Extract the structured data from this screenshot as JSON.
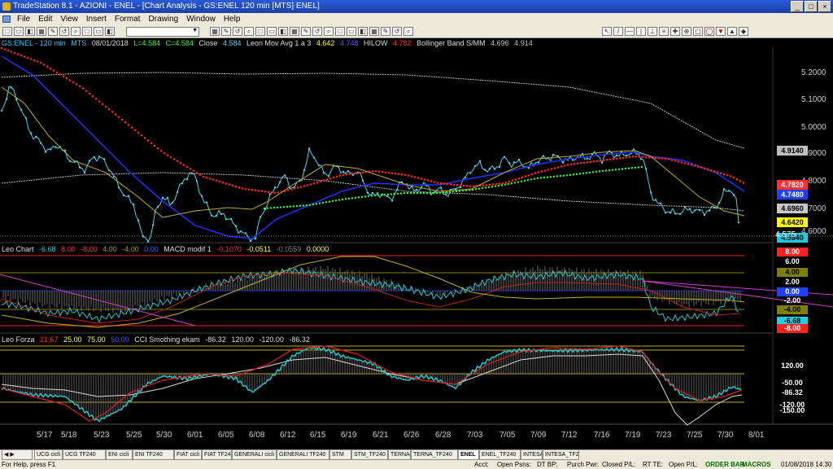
{
  "window": {
    "title": "TradeStation 8.1 - AZIONI - ENEL - [Chart Analysis - GS:ENEL  120 min  [MTS] ENEL]"
  },
  "menu": [
    "File",
    "Edit",
    "View",
    "Insert",
    "Format",
    "Drawing",
    "Window",
    "Help"
  ],
  "header": {
    "symbol": "GS:ENEL - 120 min",
    "source": "MTS",
    "date": "08/01/2018",
    "low": "L=4.584",
    "close": "C=4.584",
    "close_label": "Close",
    "close_val": "4.584",
    "ma_label": "Leon Mov Avg 1 a 3",
    "ma_val": "4.642",
    "ma_val2": "4.748",
    "hilow_label": "HILOW",
    "hilow_val": "4.782",
    "bb_label": "Bollinger Band S/MM",
    "bb_val1": "4.696",
    "bb_val2": "4.914"
  },
  "panel2_header": {
    "label": "Leo Chart",
    "v1": "-6.68",
    "v2": "8.00",
    "v3": "-8.00",
    "v4": "4.00",
    "v5": "-4.00",
    "v6": "0.00",
    "macd_label": "MACD modif 1",
    "m1": "-0.1070",
    "m2": "-0.0511",
    "m3": "-0.0559",
    "m4": "0.0000"
  },
  "panel3_header": {
    "label": "Leo Forza",
    "v1": "21.67",
    "v2": "25.00",
    "v3": "75.00",
    "v4": "50.00",
    "cci_label": "CCI Smothing ekam",
    "c1": "-86.32",
    "c2": "120.00",
    "c3": "-120.00",
    "c4": "-86.32"
  },
  "price_axis": [
    "5.2000",
    "5.1000",
    "5.0000",
    "4.9000",
    "4.8000",
    "4.7000",
    "4.6000"
  ],
  "price_boxes": [
    {
      "text": "4.9140",
      "bg": "#bfbfbf"
    },
    {
      "text": "4.7820",
      "bg": "#ff3030"
    },
    {
      "text": "4.7480",
      "bg": "#2040ff"
    },
    {
      "text": "4.6960",
      "bg": "#c8c8c8"
    },
    {
      "text": "4.6420",
      "bg": "#ffff00"
    },
    {
      "text": "4.5840",
      "bg": "#20c8e0"
    }
  ],
  "last_price_label": "4.575",
  "panel2_axis": [
    {
      "text": "8.00",
      "bg": "#ff2020"
    },
    {
      "text": "6.00",
      "bg": ""
    },
    {
      "text": "4.00",
      "bg": "#808000"
    },
    {
      "text": "2.00",
      "bg": ""
    },
    {
      "text": "0.00",
      "bg": "#2040ff"
    },
    {
      "text": "-2.00",
      "bg": ""
    },
    {
      "text": "-4.00",
      "bg": "#808000"
    },
    {
      "text": "-6.68",
      "bg": "#20d0e0"
    },
    {
      "text": "-8.00",
      "bg": "#ff2020"
    }
  ],
  "panel3_axis": [
    {
      "text": "120.00",
      "bg": ""
    },
    {
      "text": "-50.00",
      "bg": ""
    },
    {
      "text": "-86.32",
      "bg": ""
    },
    {
      "text": "-120.00",
      "bg": ""
    },
    {
      "text": "-150.00",
      "bg": ""
    }
  ],
  "dates": [
    "5/17",
    "5/18",
    "5/23",
    "5/25",
    "5/30",
    "6/01",
    "6/05",
    "6/08",
    "6/12",
    "6/15",
    "6/19",
    "6/21",
    "6/26",
    "6/28",
    "7/03",
    "7/05",
    "7/09",
    "7/12",
    "7/16",
    "7/19",
    "7/23",
    "7/25",
    "7/30",
    "8/01"
  ],
  "tabs": [
    "UCG cicli",
    "UCG TF240",
    "ENI cicli",
    "ENI TF240",
    "FIAT cicli",
    "FIAT TF240",
    "GENERALI cicli",
    "GENERALI TF240",
    "STM",
    "STM_TF240",
    "TERNA",
    "TERNA_TF240",
    "ENEL",
    "ENEL_TF240",
    "INTESA",
    "INTESA_TF240"
  ],
  "active_tab": "ENEL",
  "status": {
    "help": "For Help, press F1",
    "acct": "Acct:",
    "open_psns": "Open Psns:",
    "dt_bp": "DT BP:",
    "purch_pwr": "Purch Pwr:",
    "closed_pl": "Closed P/L:",
    "rt_te": "RT TE:",
    "open_pl": "Open P/L:",
    "order_bar": "ORDER BAR",
    "macros": "MACROS",
    "datetime": "01/08/2018 14:30"
  },
  "colors": {
    "price": "#3fd8f0",
    "ma_fast": "#c0b020",
    "ma_slow": "#2030ff",
    "hilow": "#ff2020",
    "bb": "#c0c0c0",
    "green": "#30ff30",
    "magenta": "#d040d0"
  }
}
